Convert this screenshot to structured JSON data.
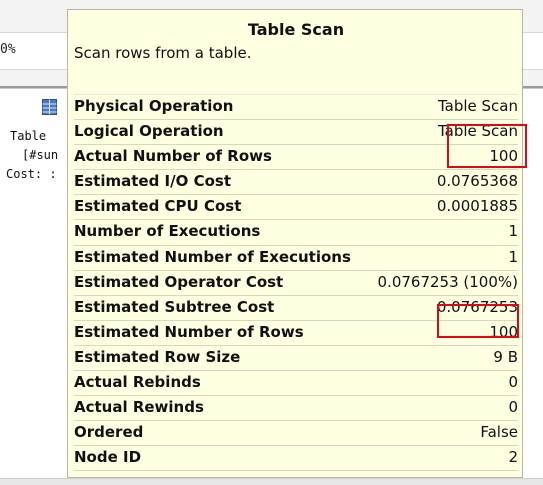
{
  "background": {
    "percent_text": "0%",
    "node_lines": [
      "Table",
      "[#sun",
      "Cost: :"
    ]
  },
  "tooltip": {
    "title": "Table Scan",
    "description": "Scan rows from a table.",
    "rows": [
      {
        "label": "Physical Operation",
        "value": "Table Scan"
      },
      {
        "label": "Logical Operation",
        "value": "Table Scan"
      },
      {
        "label": "Actual Number of Rows",
        "value": "100"
      },
      {
        "label": "Estimated I/O Cost",
        "value": "0.0765368"
      },
      {
        "label": "Estimated CPU Cost",
        "value": "0.0001885"
      },
      {
        "label": "Number of Executions",
        "value": "1"
      },
      {
        "label": "Estimated Number of Executions",
        "value": "1"
      },
      {
        "label": "Estimated Operator Cost",
        "value": "0.0767253 (100%)"
      },
      {
        "label": "Estimated Subtree Cost",
        "value": "0.0767253"
      },
      {
        "label": "Estimated Number of Rows",
        "value": "100"
      },
      {
        "label": "Estimated Row Size",
        "value": "9 B"
      },
      {
        "label": "Actual Rebinds",
        "value": "0"
      },
      {
        "label": "Actual Rewinds",
        "value": "0"
      },
      {
        "label": "Ordered",
        "value": "False"
      },
      {
        "label": "Node ID",
        "value": "2"
      }
    ]
  },
  "colors": {
    "tooltip_bg": "#ffffe1",
    "highlight": "#e30613"
  },
  "icons": [
    "table-scan-icon"
  ]
}
